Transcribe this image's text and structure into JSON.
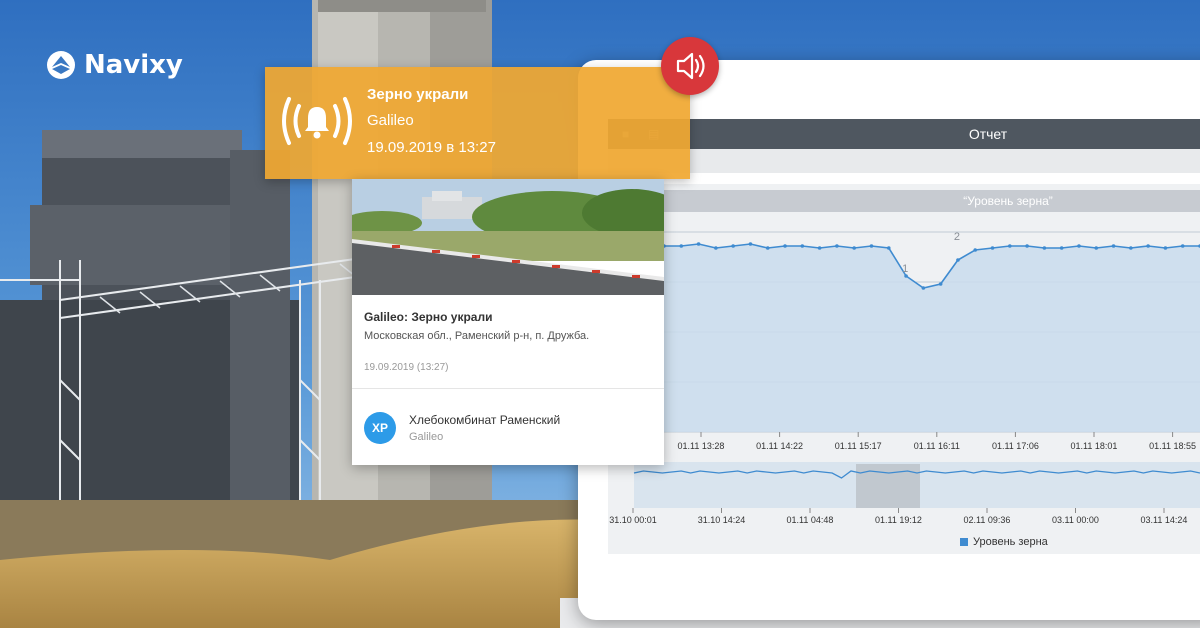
{
  "brand": {
    "name": "Navixy"
  },
  "alert": {
    "title": "Зерно украли",
    "tracker": "Galileo",
    "datetime": "19.09.2019 в 13:27",
    "icon": "bell-icon",
    "sound_icon": "speaker-icon",
    "color": "#f0a832"
  },
  "event_card": {
    "title": "Galileo: Зерно украли",
    "address": "Московская обл., Раменский р-н, п. Дружба.",
    "date": "19.09.2019 (13:27)",
    "avatar_initials": "ХР",
    "object_name": "Хлебокомбинат Раменский",
    "object_tracker": "Galileo"
  },
  "report": {
    "title": "Отчет",
    "toolbar_icons": [
      "trash-icon",
      "print-icon"
    ]
  },
  "chart_data": {
    "type": "line",
    "title": "“Уровень зерна”",
    "series": [
      {
        "name": "Уровень зерна",
        "color": "#3f8bd0",
        "values": [
          0.93,
          0.93,
          0.94,
          0.92,
          0.93,
          0.94,
          0.92,
          0.93,
          0.93,
          0.92,
          0.93,
          0.92,
          0.93,
          0.92,
          0.78,
          0.72,
          0.74,
          0.86,
          0.91,
          0.92,
          0.93,
          0.93,
          0.92,
          0.92,
          0.93,
          0.92,
          0.93,
          0.92,
          0.93,
          0.92,
          0.93,
          0.93
        ]
      }
    ],
    "annotations": [
      "1",
      "2"
    ],
    "x_ticks": [
      "01.11 13:28",
      "01.11 14:22",
      "01.11 15:17",
      "01.11 16:11",
      "01.11 17:06",
      "01.11 18:01",
      "01.11 18:55"
    ],
    "navigator_ticks": [
      "31.10 00:01",
      "31.10 14:24",
      "01.11 04:48",
      "01.11 19:12",
      "02.11 09:36",
      "03.11 00:00",
      "03.11 14:24"
    ],
    "legend": "Уровень зерна",
    "legend_position": "bottom",
    "grid": true
  }
}
